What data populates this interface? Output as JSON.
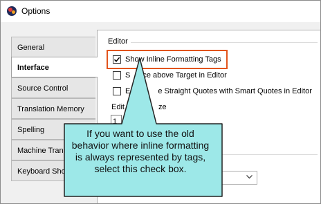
{
  "window": {
    "title": "Options",
    "app_icon": "globe-app-icon"
  },
  "tabs": [
    {
      "label": "General",
      "selected": false
    },
    {
      "label": "Interface",
      "selected": true
    },
    {
      "label": "Source Control",
      "selected": false
    },
    {
      "label": "Translation Memory",
      "selected": false
    },
    {
      "label": "Spelling",
      "selected": false
    },
    {
      "label": "Machine Trans",
      "selected": false
    },
    {
      "label": "Keyboard Sho",
      "selected": false
    }
  ],
  "editor": {
    "group_label": "Editor",
    "options": [
      {
        "label": "Show Inline Formatting Tags",
        "checked": true,
        "highlighted": true
      },
      {
        "label": "S",
        "label_tail": "ce above Target in Editor",
        "checked": false
      },
      {
        "label": "E",
        "label_tail": "e Straight Quotes with Smart Quotes in Editor",
        "checked": false
      }
    ],
    "partial_label_left": "Edit",
    "partial_label_right": "ze",
    "partial_field_value": "1"
  },
  "callout": {
    "text": "If you want to use the old behavior where inline formatting is always represented by tags, select this check box.",
    "fill": "#9de8e8",
    "border": "#222222"
  },
  "highlight_color": "#e2541c"
}
